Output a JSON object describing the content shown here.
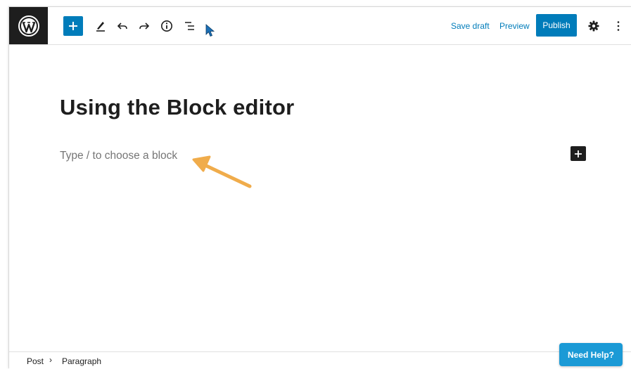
{
  "toolbar": {
    "logo_icon": "wordpress-logo-icon",
    "inserter_icon": "plus-icon",
    "tools_icon": "pencil-icon",
    "undo_icon": "undo-icon",
    "redo_icon": "redo-icon",
    "details_icon": "info-icon",
    "outline_icon": "list-view-icon",
    "save_draft_label": "Save draft",
    "preview_label": "Preview",
    "publish_label": "Publish",
    "settings_icon": "gear-icon",
    "options_icon": "more-vertical-icon"
  },
  "editor": {
    "title": "Using the Block editor",
    "placeholder": "Type / to choose a block",
    "block_inserter_icon": "plus-icon"
  },
  "footer": {
    "breadcrumbs": [
      "Post",
      "Paragraph"
    ],
    "separator": "›"
  },
  "help_button": {
    "label": "Need Help?"
  },
  "colors": {
    "accent": "#007cba",
    "dark": "#1e1e1e",
    "help": "#1b9ad6",
    "annotation_arrow": "#f0ac4b"
  }
}
